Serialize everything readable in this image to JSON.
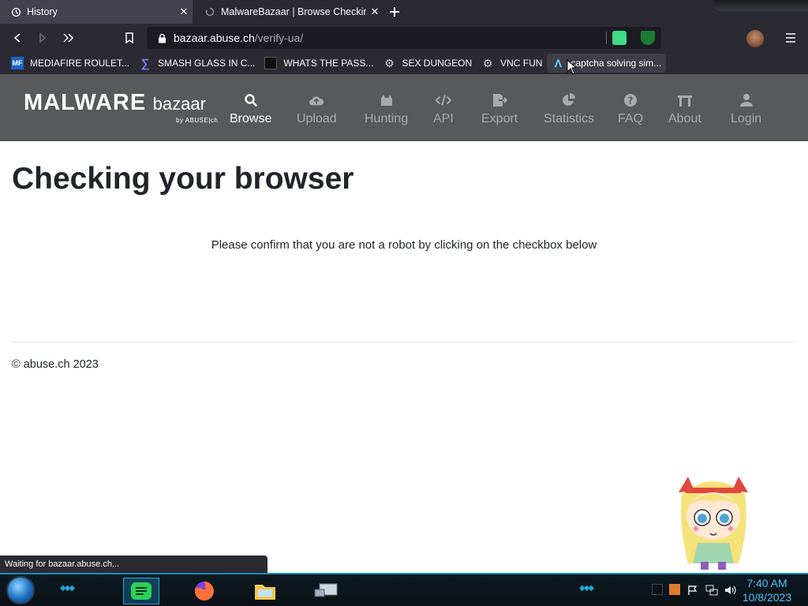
{
  "browser": {
    "tabs": [
      {
        "title": "History",
        "active": true
      },
      {
        "title": "MalwareBazaar | Browse Checking",
        "active": false
      }
    ],
    "url": {
      "host": "bazaar.abuse.ch",
      "path": "/verify-ua/"
    },
    "bookmarks": [
      {
        "label": "MEDIAFIRE ROULET...",
        "icon": "mediafire-icon"
      },
      {
        "label": "SMASH GLASS IN C...",
        "icon": "sigma-icon"
      },
      {
        "label": "WHATS THE PASS...",
        "icon": "site-icon"
      },
      {
        "label": "SEX DUNGEON",
        "icon": "gear-icon"
      },
      {
        "label": "VNC FUN",
        "icon": "gear-icon"
      },
      {
        "label": "captcha solving sim...",
        "icon": "lambda-icon"
      }
    ],
    "status": "Waiting for bazaar.abuse.ch..."
  },
  "site": {
    "brand_main": "MALWARE",
    "brand_sub": "bazaar",
    "brand_by": "by ABUSE|ch",
    "nav": [
      {
        "label": "Browse",
        "icon": "search-icon",
        "active": true
      },
      {
        "label": "Upload",
        "icon": "cloud-upload-icon",
        "active": false
      },
      {
        "label": "Hunting",
        "icon": "hunting-icon",
        "active": false
      },
      {
        "label": "API",
        "icon": "code-icon",
        "active": false
      },
      {
        "label": "Export",
        "icon": "export-icon",
        "active": false
      },
      {
        "label": "Statistics",
        "icon": "pie-chart-icon",
        "active": false
      },
      {
        "label": "FAQ",
        "icon": "question-icon",
        "active": false
      },
      {
        "label": "About",
        "icon": "building-icon",
        "active": false
      },
      {
        "label": "Login",
        "icon": "user-icon",
        "active": false
      }
    ]
  },
  "page": {
    "heading": "Checking your browser",
    "message": "Please confirm that you are not a robot by clicking on the checkbox below",
    "footer": "© abuse.ch 2023"
  },
  "taskbar": {
    "time": "7:40 AM",
    "date": "10/8/2023"
  },
  "colors": {
    "chrome_bg": "#2b2a33",
    "nav_bg": "#58595b",
    "clock": "#4fc3f7",
    "taskbar_accent": "#1fa6d6"
  }
}
